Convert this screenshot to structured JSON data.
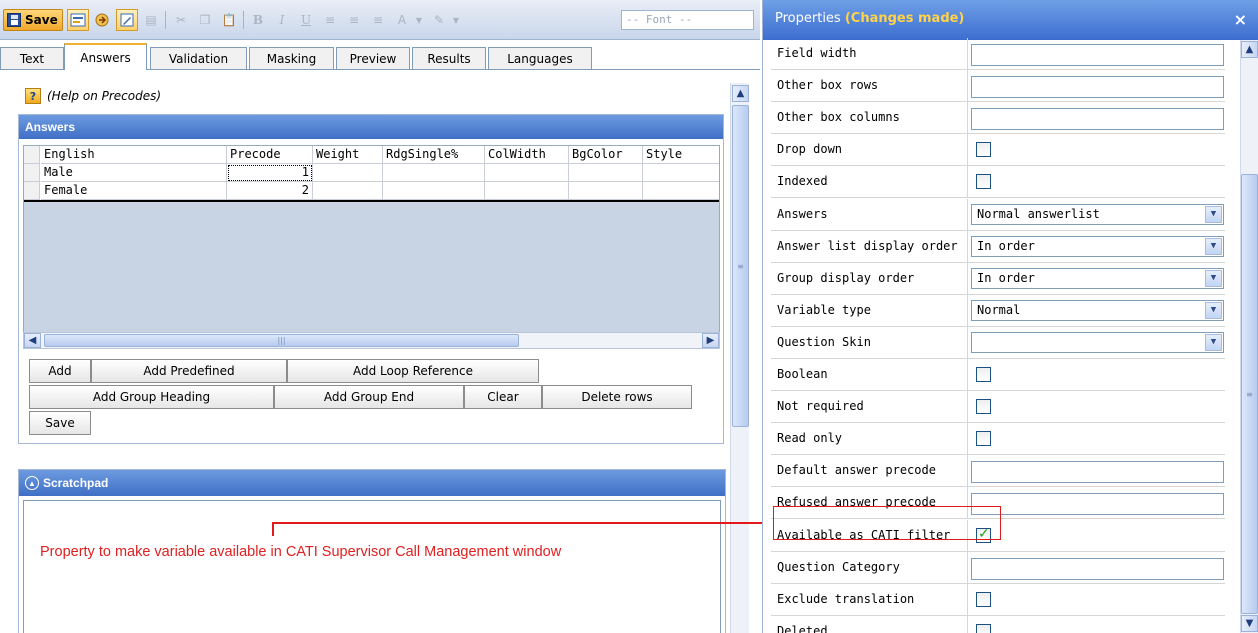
{
  "toolbar": {
    "save_label": "Save",
    "bold": "B",
    "italic": "I",
    "underline": "U",
    "font_placeholder": "-- Font --"
  },
  "tabs": [
    {
      "label": "Text"
    },
    {
      "label": "Answers",
      "selected": true
    },
    {
      "label": "Validation"
    },
    {
      "label": "Masking"
    },
    {
      "label": "Preview"
    },
    {
      "label": "Results"
    },
    {
      "label": "Languages"
    }
  ],
  "help": {
    "label": "(Help on Precodes)"
  },
  "answers_panel": {
    "title": "Answers",
    "columns": [
      "English",
      "Precode",
      "Weight",
      "RdgSingle%",
      "ColWidth",
      "BgColor",
      "Style"
    ],
    "rows": [
      {
        "english": "Male",
        "precode": "1"
      },
      {
        "english": "Female",
        "precode": "2"
      }
    ],
    "buttons": {
      "add": "Add",
      "add_predefined": "Add Predefined",
      "add_loop_reference": "Add Loop Reference",
      "add_group_heading": "Add Group Heading",
      "add_group_end": "Add Group End",
      "clear": "Clear",
      "delete_rows": "Delete rows",
      "save": "Save"
    }
  },
  "scratchpad": {
    "title": "Scratchpad"
  },
  "annotation": {
    "text": "Property to make variable available in CATI Supervisor Call Management window"
  },
  "properties": {
    "title": "Properties",
    "status": "(Changes made)",
    "close_label": "×",
    "rows": [
      {
        "label": "Field width",
        "type": "text",
        "value": ""
      },
      {
        "label": "Other box rows",
        "type": "text",
        "value": ""
      },
      {
        "label": "Other box columns",
        "type": "text",
        "value": ""
      },
      {
        "label": "Drop down",
        "type": "check",
        "checked": false
      },
      {
        "label": "Indexed",
        "type": "check",
        "checked": false
      },
      {
        "label": "Answers",
        "type": "select",
        "value": "Normal answerlist"
      },
      {
        "label": "Answer list display order",
        "type": "select",
        "value": "In order"
      },
      {
        "label": "Group display order",
        "type": "select",
        "value": "In order"
      },
      {
        "label": "Variable type",
        "type": "select",
        "value": "Normal"
      },
      {
        "label": "Question Skin",
        "type": "select",
        "value": ""
      },
      {
        "label": "Boolean",
        "type": "check",
        "checked": false
      },
      {
        "label": "Not required",
        "type": "check",
        "checked": false
      },
      {
        "label": "Read only",
        "type": "check",
        "checked": false
      },
      {
        "label": "Default answer precode",
        "type": "text",
        "value": ""
      },
      {
        "label": "Refused answer precode",
        "type": "text",
        "value": ""
      },
      {
        "label": "Available as CATI filter",
        "type": "check",
        "checked": true
      },
      {
        "label": "Question Category",
        "type": "text",
        "value": ""
      },
      {
        "label": "Exclude translation",
        "type": "check",
        "checked": false
      },
      {
        "label": "Deleted",
        "type": "check",
        "checked": false
      }
    ]
  },
  "colors": {
    "header_blue": "#3f6fc6",
    "changes_made": "#ffd24a",
    "annotation_red": "#e21a1a",
    "check_green": "#21a121"
  }
}
